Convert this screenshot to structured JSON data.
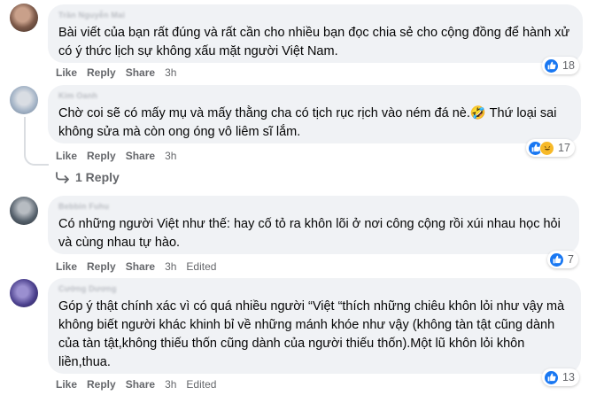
{
  "comments": [
    {
      "author": "Trần Nguyễn Mai",
      "text": "Bài viết của bạn rất đúng và rất cần cho nhiều bạn đọc chia sẻ cho cộng đồng để hành xử có ý thức lịch sự không xấu mặt người Việt Nam.",
      "actions": {
        "like": "Like",
        "reply": "Reply",
        "share": "Share",
        "time": "3h",
        "edited": ""
      },
      "reactions": {
        "icons": [
          "like-icon"
        ],
        "count": "18"
      },
      "avatar_color": "#7d5a4a"
    },
    {
      "author": "Kim Oanh",
      "text": "Chờ coi sẽ có mấy mụ và mấy thằng cha có tịch rục rịch vào ném đá nè.🤣 Thứ loại sai không sửa mà còn ong óng vô liêm sĩ lắm.",
      "actions": {
        "like": "Like",
        "reply": "Reply",
        "share": "Share",
        "time": "3h",
        "edited": ""
      },
      "reactions": {
        "icons": [
          "like-icon",
          "haha-icon"
        ],
        "count": "17"
      },
      "avatar_color": "#a3b3c6"
    },
    {
      "author": "Bebbin Fuhu",
      "text": "Có những người Việt như thế: hay cố tỏ ra khôn lõi ở nơi công cộng rồi xúi nhau học hỏi và cùng nhau tự hào.",
      "actions": {
        "like": "Like",
        "reply": "Reply",
        "share": "Share",
        "time": "3h",
        "edited": "Edited"
      },
      "reactions": {
        "icons": [
          "like-icon"
        ],
        "count": "7"
      },
      "avatar_color": "#55606b"
    },
    {
      "author": "Cường Dương",
      "text": "Góp ý thật chính xác vì có quá nhiều người “Việt “thích những chiêu khôn lỏi như vậy mà không biết người khác khinh bỉ về những mánh khóe như vậy (không tàn tật cũng dành của tàn tật,không thiếu thốn cũng dành của người thiếu thốn).Một lũ khôn lỏi khôn liền,thua.",
      "actions": {
        "like": "Like",
        "reply": "Reply",
        "share": "Share",
        "time": "3h",
        "edited": "Edited"
      },
      "reactions": {
        "icons": [
          "like-icon"
        ],
        "count": "13"
      },
      "avatar_color": "#4a3f8c"
    }
  ],
  "replies_toggle": "1 Reply",
  "colors": {
    "like_blue": "#1877f2",
    "bubble": "#f0f2f5",
    "meta_gray": "#65676b"
  }
}
